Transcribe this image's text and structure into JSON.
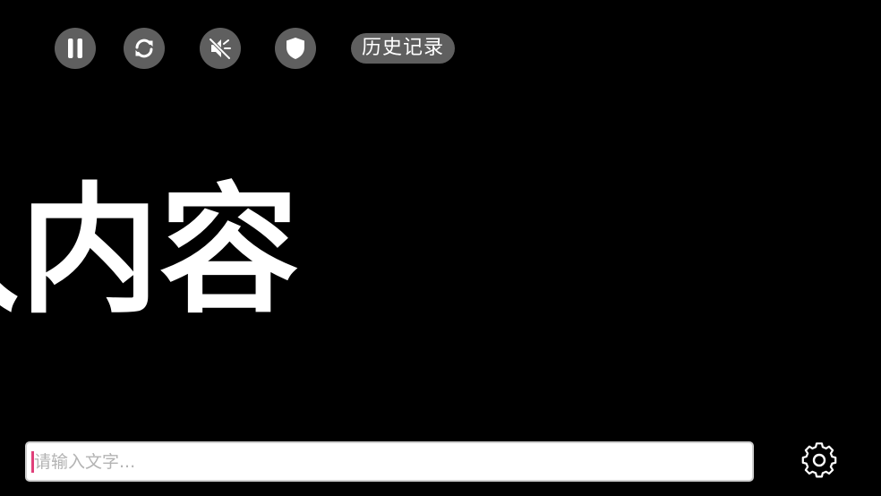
{
  "controls": {
    "pause_icon": "pause-icon",
    "refresh_icon": "refresh-icon",
    "mute_icon": "mute-icon",
    "shield_icon": "shield-icon",
    "history_label": "历史记录"
  },
  "display": {
    "scroll_text": "入内容"
  },
  "input": {
    "placeholder": "请输入文字...",
    "value": ""
  },
  "settings": {
    "icon": "gear-icon"
  },
  "colors": {
    "background": "#000000",
    "button_bg": "#5f5f5f",
    "text": "#ffffff",
    "caret": "#e0407a",
    "placeholder": "#b3b3b3"
  }
}
